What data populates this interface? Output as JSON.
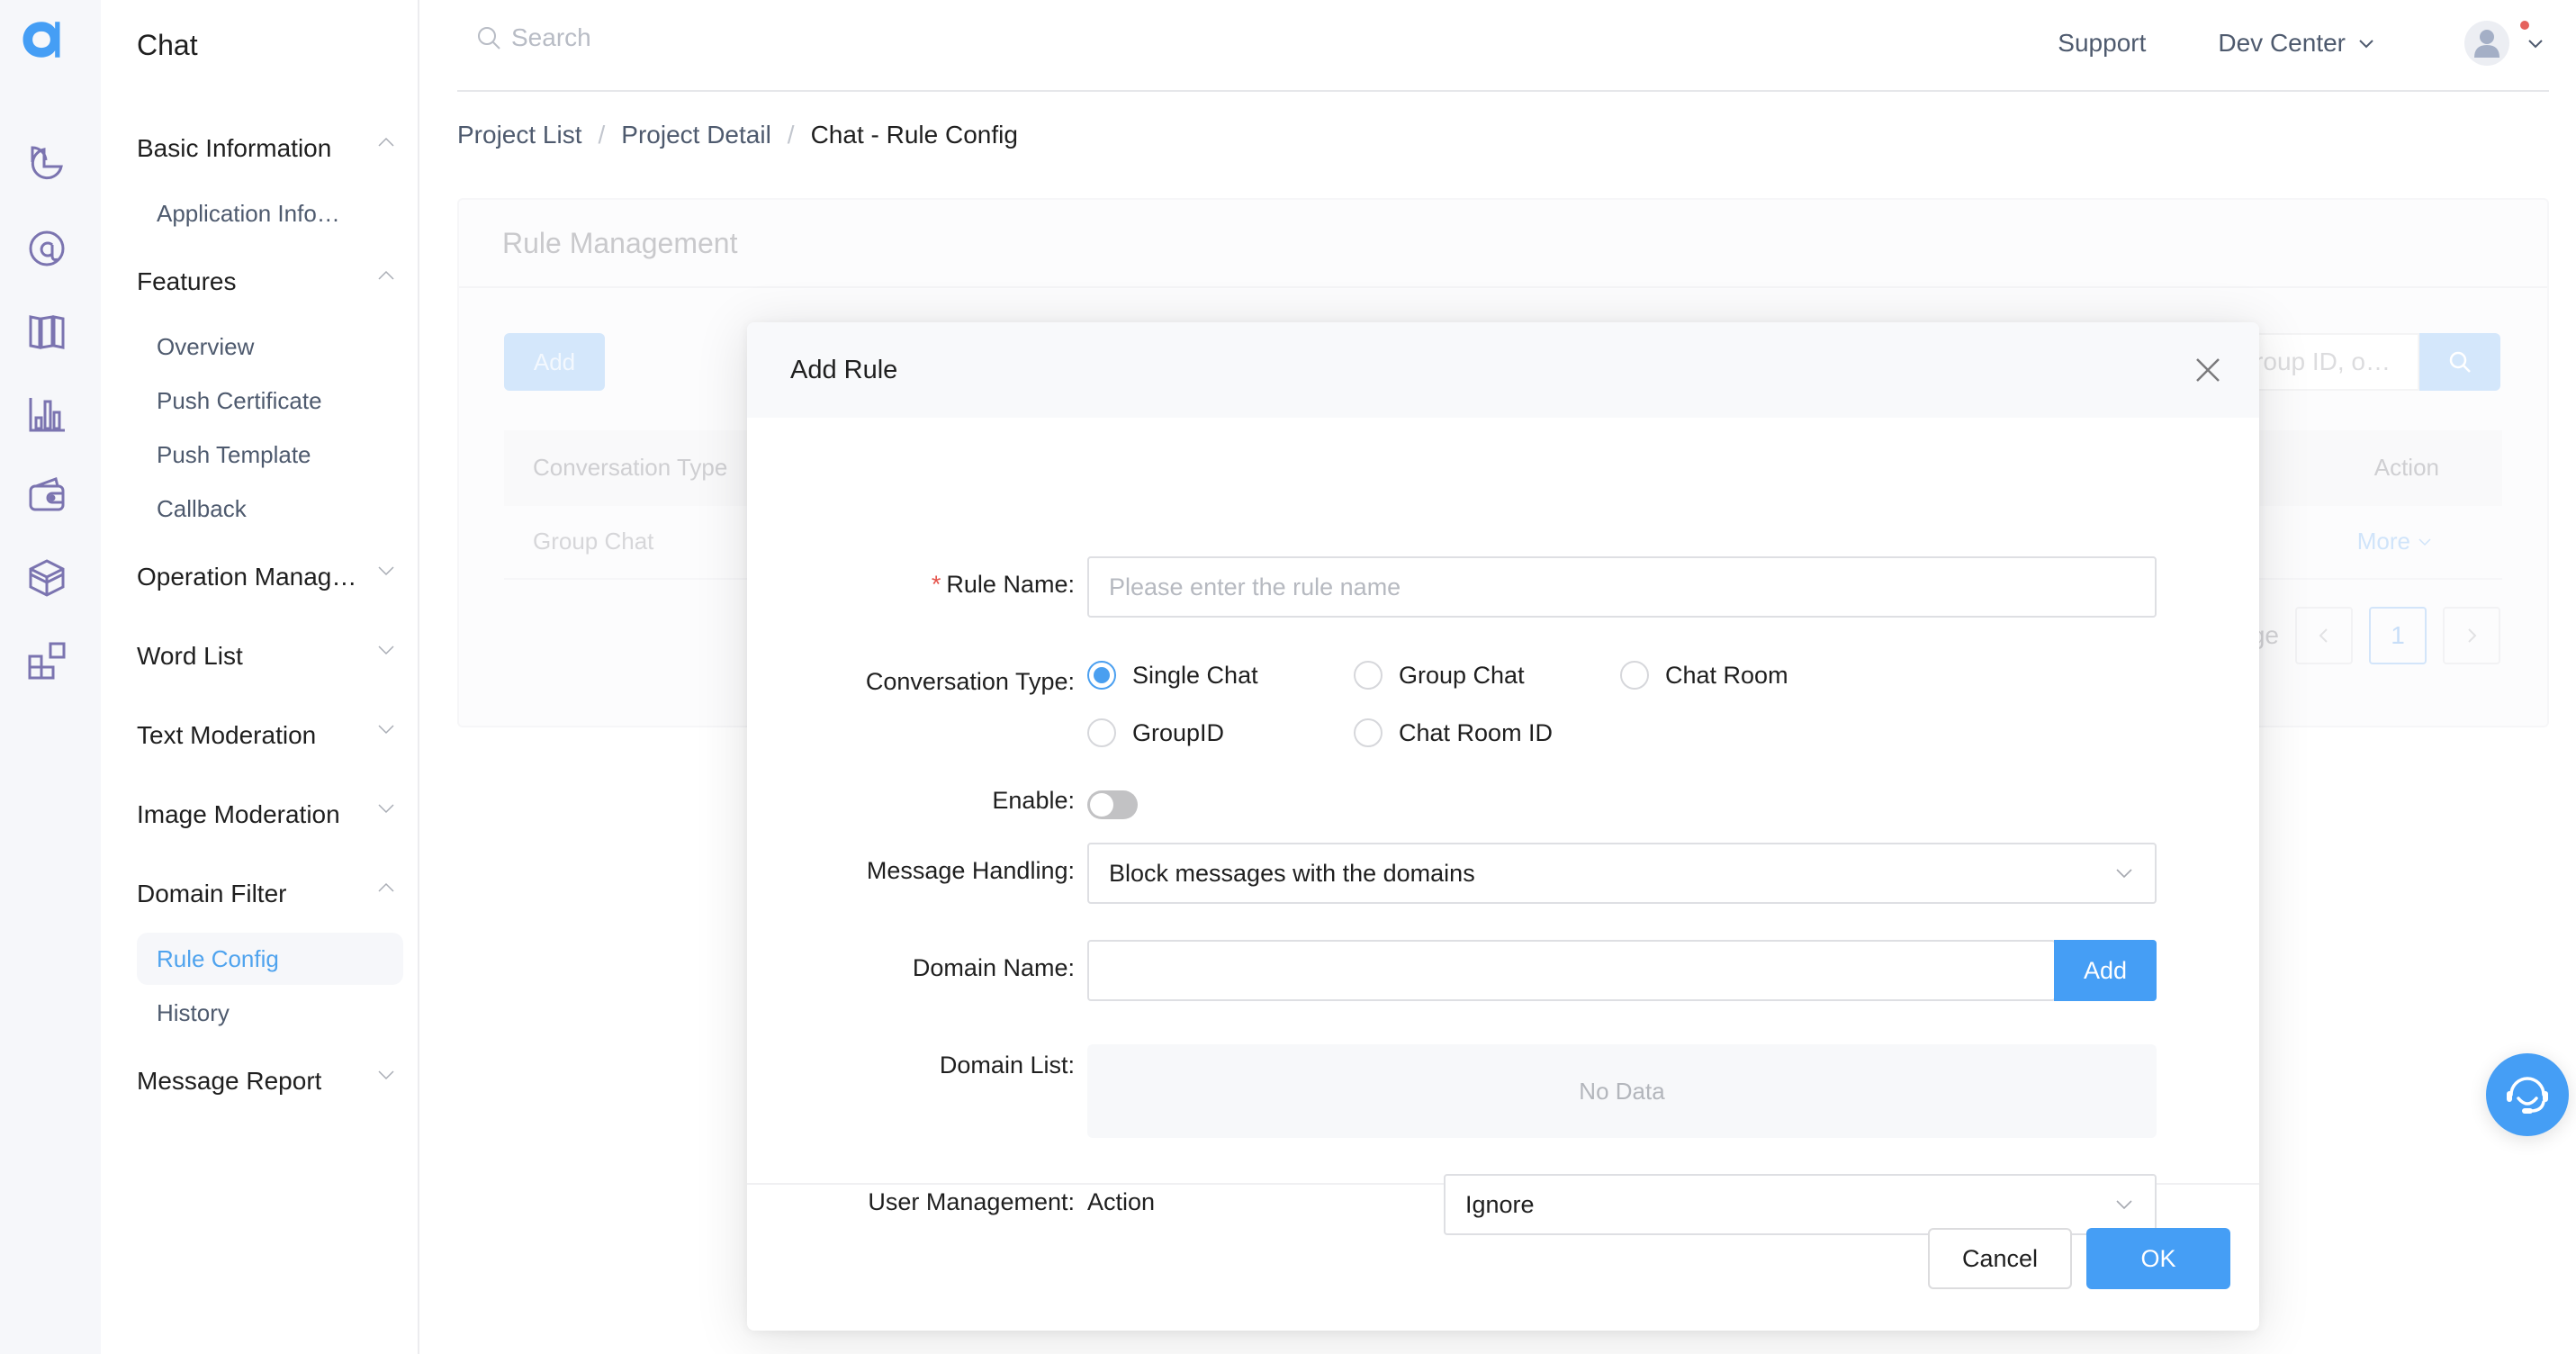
{
  "app": {
    "logo": "agora-logo",
    "colors": {
      "accent": "#459ef5",
      "rail_icon": "#7b74b0",
      "required": "#e5534b",
      "notification": "#e5625d"
    }
  },
  "rail": {
    "icons": [
      "pie-chart-icon",
      "at-sign-icon",
      "map-icon",
      "bar-chart-icon",
      "wallet-icon",
      "box-icon",
      "apps-icon"
    ]
  },
  "sidebar": {
    "title": "Chat",
    "groups": [
      {
        "label": "Basic Information",
        "expanded": true,
        "items": [
          {
            "label": "Application Info…",
            "active": false
          }
        ]
      },
      {
        "label": "Features",
        "expanded": true,
        "items": [
          {
            "label": "Overview",
            "active": false
          },
          {
            "label": "Push Certificate",
            "active": false
          },
          {
            "label": "Push Template",
            "active": false
          },
          {
            "label": "Callback",
            "active": false
          }
        ]
      },
      {
        "label": "Operation Manag…",
        "expanded": false,
        "items": []
      },
      {
        "label": "Word List",
        "expanded": false,
        "items": []
      },
      {
        "label": "Text Moderation",
        "expanded": false,
        "items": []
      },
      {
        "label": "Image Moderation",
        "expanded": false,
        "items": []
      },
      {
        "label": "Domain Filter",
        "expanded": true,
        "items": [
          {
            "label": "Rule Config",
            "active": true
          },
          {
            "label": "History",
            "active": false
          }
        ]
      },
      {
        "label": "Message Report",
        "expanded": false,
        "items": []
      }
    ]
  },
  "header": {
    "search_placeholder": "Search",
    "support": "Support",
    "dev_center": "Dev Center",
    "has_notification": true
  },
  "breadcrumb": {
    "items": [
      "Project List",
      "Project Detail"
    ],
    "current": "Chat - Rule Config",
    "separator": "/"
  },
  "background_card": {
    "title": "Rule Management",
    "add_label": "Add",
    "search_placeholder_visible": "roup ID, o…",
    "table": {
      "headers": [
        "Conversation Type",
        "Action"
      ],
      "rows": [
        {
          "conversation_type": "Group Chat",
          "action": "More"
        }
      ]
    },
    "pager": {
      "label_partial": "ge",
      "current_page": "1"
    }
  },
  "modal": {
    "title": "Add Rule",
    "fields": {
      "rule_name": {
        "label": "Rule Name",
        "required": true,
        "placeholder": "Please enter the rule name",
        "value": ""
      },
      "conversation_type": {
        "label": "Conversation Type",
        "options": [
          "Single Chat",
          "Group Chat",
          "Chat Room",
          "GroupID",
          "Chat Room ID"
        ],
        "selected": "Single Chat"
      },
      "enable": {
        "label": "Enable",
        "on": false
      },
      "message_handling": {
        "label": "Message Handling",
        "value": "Block messages with the domains"
      },
      "domain_name": {
        "label": "Domain Name",
        "value": "",
        "add_label": "Add"
      },
      "domain_list": {
        "label": "Domain List",
        "empty_text": "No Data"
      },
      "user_management": {
        "label": "User Management",
        "sub_label": "Action",
        "value": "Ignore"
      }
    },
    "colon": ":",
    "cancel_label": "Cancel",
    "ok_label": "OK"
  },
  "support_fab": {
    "icon": "headset-icon"
  }
}
